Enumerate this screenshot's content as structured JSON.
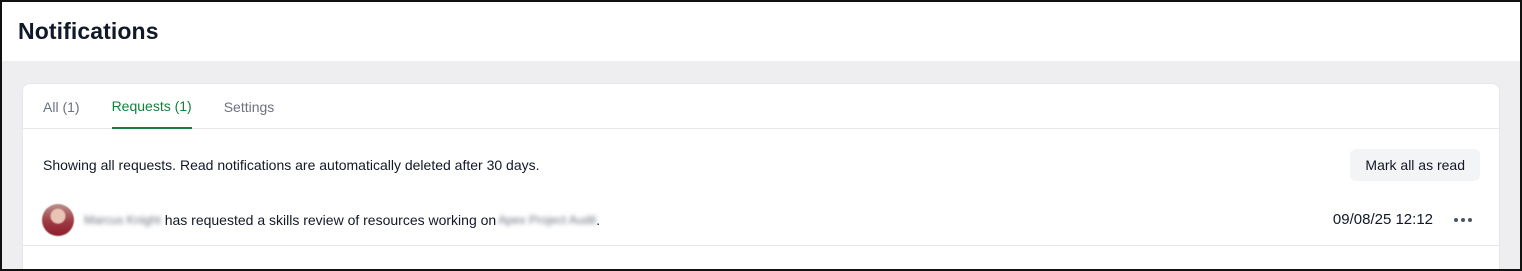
{
  "header": {
    "title": "Notifications"
  },
  "tabs": [
    {
      "label": "All (1)",
      "active": false
    },
    {
      "label": "Requests (1)",
      "active": true
    },
    {
      "label": "Settings",
      "active": false
    }
  ],
  "info": {
    "text": "Showing all requests. Read notifications are automatically deleted after 30 days.",
    "mark_all_label": "Mark all as read"
  },
  "notifications": [
    {
      "user_name": "Marcus Knight",
      "message": "has requested a skills review of resources working on",
      "project": "Apex Project Audit",
      "punctuation": ".",
      "timestamp": "09/08/25 12:12",
      "avatar_icon": "user-avatar",
      "more_icon": "more-horizontal-icon"
    }
  ],
  "colors": {
    "accent": "#15803d",
    "text": "#111827",
    "muted": "#6b7280",
    "page_bg": "#eeeef1"
  }
}
